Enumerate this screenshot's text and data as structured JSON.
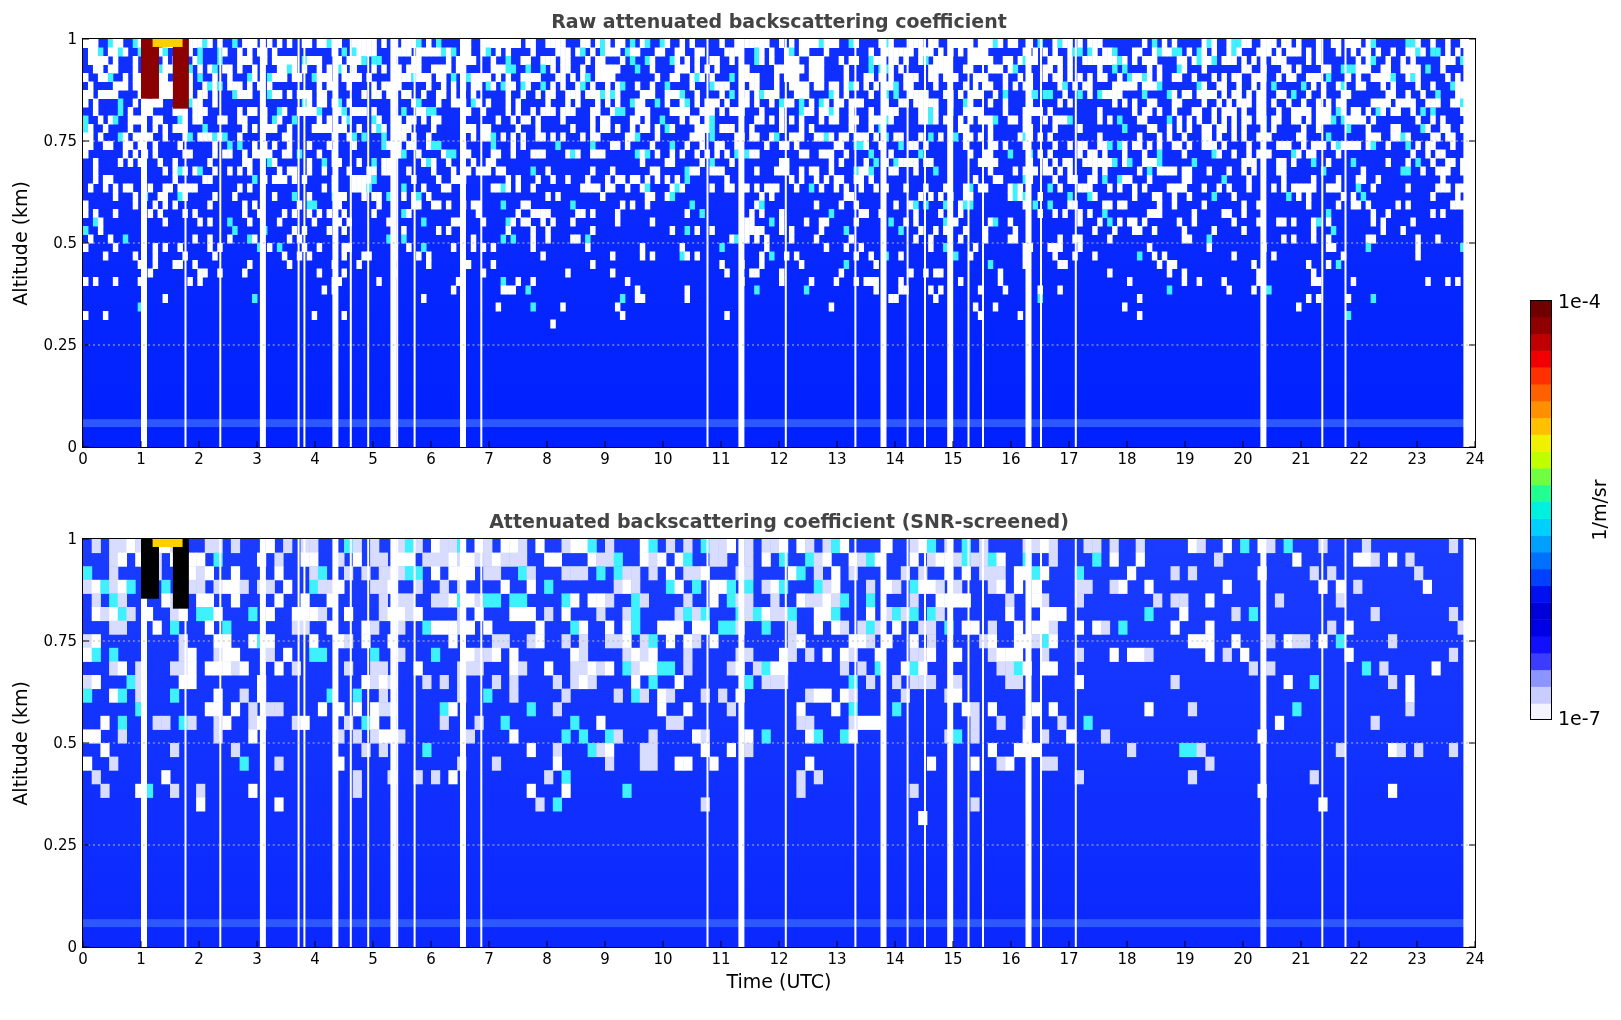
{
  "panels": [
    {
      "kind": "raw",
      "title": "Raw attenuated backscattering coefficient",
      "ylabel": "Altitude (km)",
      "yticks": [
        "1",
        "0.75",
        "0.5",
        "0.25",
        "0"
      ],
      "xticks": [
        "0",
        "1",
        "2",
        "3",
        "4",
        "5",
        "6",
        "7",
        "8",
        "9",
        "10",
        "11",
        "12",
        "13",
        "14",
        "15",
        "16",
        "17",
        "18",
        "19",
        "20",
        "21",
        "22",
        "23",
        "24"
      ]
    },
    {
      "kind": "screened",
      "title": "Attenuated backscattering coefficient (SNR-screened)",
      "ylabel": "Altitude (km)",
      "yticks": [
        "1",
        "0.75",
        "0.5",
        "0.25",
        "0"
      ],
      "xticks": [
        "0",
        "1",
        "2",
        "3",
        "4",
        "5",
        "6",
        "7",
        "8",
        "9",
        "10",
        "11",
        "12",
        "13",
        "14",
        "15",
        "16",
        "17",
        "18",
        "19",
        "20",
        "21",
        "22",
        "23",
        "24"
      ]
    }
  ],
  "xlabel": "Time (UTC)",
  "colorbar": {
    "max": "1e-4",
    "min": "1e-7",
    "label": "1/m/sr"
  }
}
